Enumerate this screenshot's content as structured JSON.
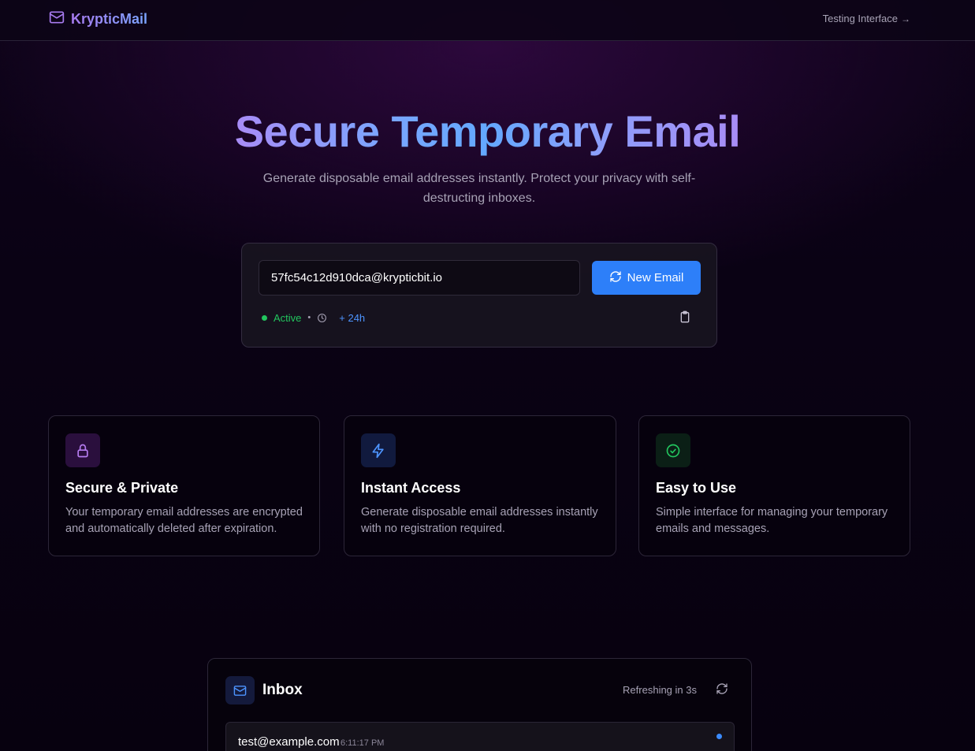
{
  "header": {
    "logo_text": "KrypticMail",
    "testing_link": "Testing Interface",
    "testing_arrow": "→"
  },
  "hero": {
    "title": "Secure Temporary Email",
    "subtitle": "Generate disposable email addresses instantly. Protect your privacy with self-destructing inboxes."
  },
  "email_box": {
    "address": "57fc54c12d910dca@krypticbit.io",
    "new_button_label": "New Email",
    "status": "Active",
    "separator": "•",
    "extend_label": "+ 24h"
  },
  "features": [
    {
      "icon": "lock-icon",
      "title": "Secure & Private",
      "description": "Your temporary email addresses are encrypted and automatically deleted after expiration."
    },
    {
      "icon": "lightning-icon",
      "title": "Instant Access",
      "description": "Generate disposable email addresses instantly with no registration required."
    },
    {
      "icon": "check-circle-icon",
      "title": "Easy to Use",
      "description": "Simple interface for managing your temporary emails and messages."
    }
  ],
  "inbox": {
    "title": "Inbox",
    "refresh_text": "Refreshing in 3s",
    "messages": [
      {
        "from": "test@example.com",
        "time": "6:11:17 PM",
        "unread": true
      }
    ]
  },
  "colors": {
    "accent_blue": "#2d7ff9",
    "status_green": "#22c55e",
    "logo_purple": "#a87bf0"
  }
}
